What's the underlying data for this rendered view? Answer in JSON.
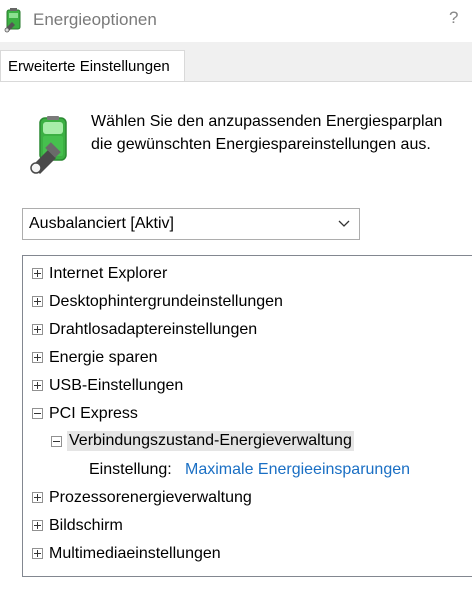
{
  "window": {
    "title": "Energieoptionen",
    "help": "?"
  },
  "tabs": [
    {
      "label": "Erweiterte Einstellungen"
    }
  ],
  "intro": {
    "line1": "Wählen Sie den anzupassenden Energiesparplan",
    "line2": "die gewünschten Energiespareinstellungen aus."
  },
  "plan_select": {
    "value": "Ausbalanciert [Aktiv]"
  },
  "tree": {
    "items": [
      {
        "label": "Internet Explorer",
        "expander": "plus"
      },
      {
        "label": "Desktophintergrundeinstellungen",
        "expander": "plus"
      },
      {
        "label": "Drahtlosadaptereinstellungen",
        "expander": "plus"
      },
      {
        "label": "Energie sparen",
        "expander": "plus"
      },
      {
        "label": "USB-Einstellungen",
        "expander": "plus"
      },
      {
        "label": "PCI Express",
        "expander": "minus"
      },
      {
        "label": "Verbindungszustand-Energieverwaltung",
        "expander": "minus"
      },
      {
        "setting_label": "Einstellung:",
        "setting_value": "Maximale Energieeinsparungen"
      },
      {
        "label": "Prozessorenergieverwaltung",
        "expander": "plus"
      },
      {
        "label": "Bildschirm",
        "expander": "plus"
      },
      {
        "label": "Multimediaeinstellungen",
        "expander": "plus"
      }
    ]
  },
  "colors": {
    "link": "#1a6fc4",
    "selection": "#e5e5e5",
    "battery_green": "#3cb043"
  }
}
